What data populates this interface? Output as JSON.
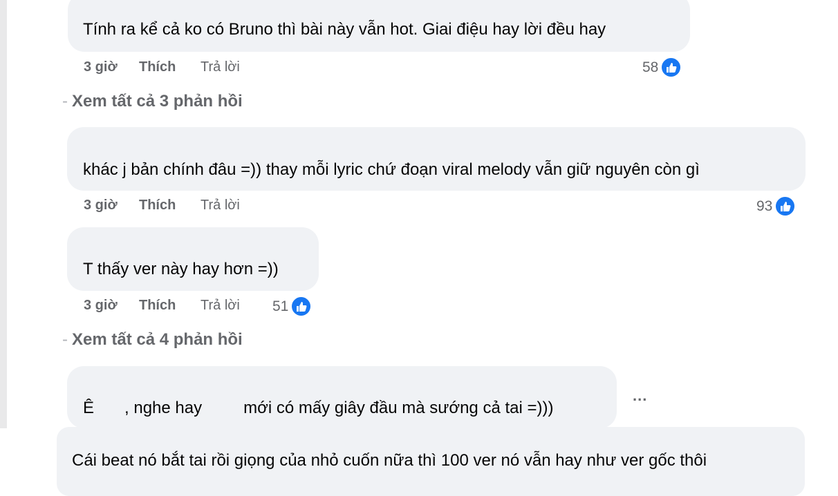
{
  "comments": [
    {
      "text": "Tính ra kể cả ko có Bruno thì bài này vẫn hot. Giai điệu hay lời đều hay",
      "time": "3 giờ",
      "like": "Thích",
      "reply": "Trả lời",
      "likes": "58"
    },
    {
      "text": "khác j bản chính đâu =)) thay mỗi lyric chứ đoạn viral melody vẫn giữ nguyên còn gì",
      "time": "3 giờ",
      "like": "Thích",
      "reply": "Trả lời",
      "likes": "93"
    },
    {
      "text": "T thấy ver này hay hơn =))",
      "time": "3 giờ",
      "like": "Thích",
      "reply": "Trả lời",
      "likes": "51"
    },
    {
      "text_a": "Ê",
      "text_b": ", nghe hay",
      "text_c": "mới có mấy giây đầu mà sướng cả tai =)))"
    },
    {
      "text": "Cái beat nó bắt tai rồi giọng của nhỏ cuốn nữa thì 100 ver nó vẫn hay như ver gốc thôi"
    }
  ],
  "view_replies": [
    "Xem tất cả 3 phản hồi",
    "Xem tất cả 4 phản hồi"
  ],
  "more_label": "...",
  "colors": {
    "bubble": "#f0f2f5",
    "meta": "#65676b",
    "like_badge": "#1877f2"
  },
  "icons": {
    "like_reaction": "thumbs-up-icon",
    "more": "more-options-icon"
  }
}
